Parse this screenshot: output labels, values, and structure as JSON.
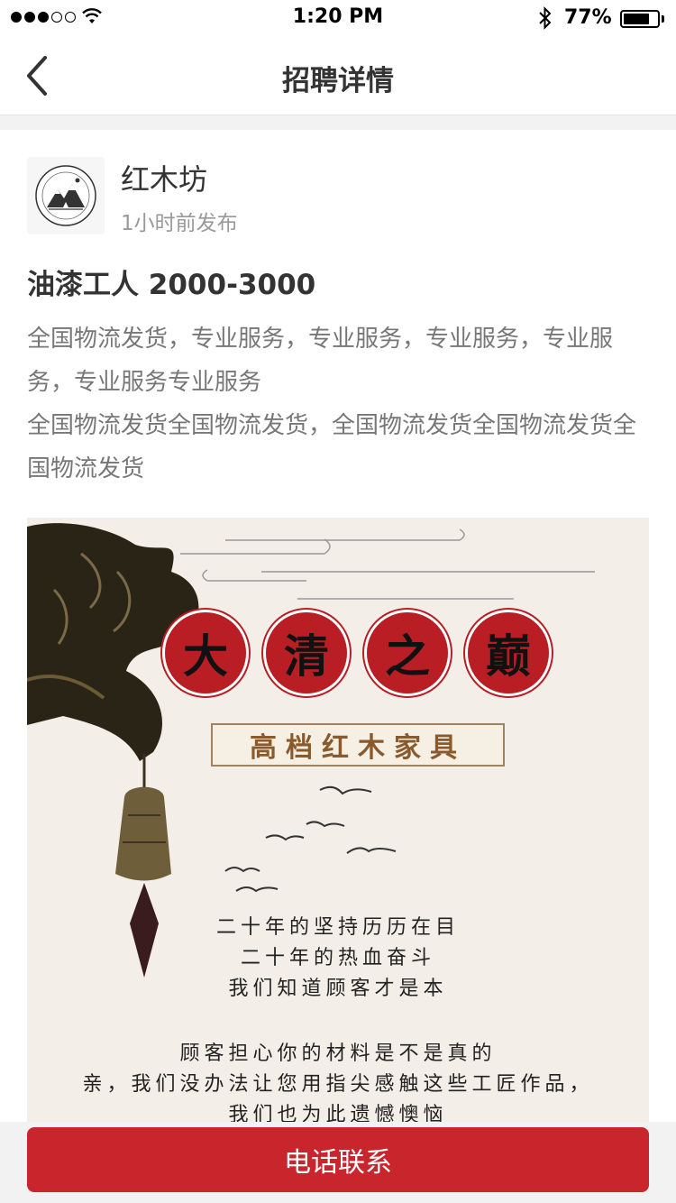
{
  "status_bar": {
    "time": "1:20 PM",
    "battery_percent": "77%",
    "battery_level": 0.77,
    "signal_bars_filled": 3,
    "signal_bars_total": 5
  },
  "nav": {
    "title": "招聘详情",
    "back_icon": "chevron-left-icon"
  },
  "company": {
    "name": "红木坊",
    "posted": "1小时前发布",
    "avatar_icon": "mountain-logo-icon"
  },
  "job": {
    "title": "油漆工人 2000-3000",
    "description": [
      "全国物流发货，专业服务，专业服务，专业服务，专业服务，专业服务专业服务",
      "全国物流发货全国物流发货，全国物流发货全国物流发货全国物流发货"
    ]
  },
  "poster": {
    "seals": [
      "大",
      "清",
      "之",
      "巅"
    ],
    "banner": "高档红木家具",
    "poem_lines": [
      "二十年的坚持历历在目",
      "二十年的热血奋斗",
      "我们知道顾客才是本",
      "顾客担心你的材料是不是真的",
      "亲，我们没办法让您用指尖感触这些工匠作品，",
      "我们也为此遗憾懊恼"
    ],
    "colors": {
      "seal_red": "#b81e24",
      "banner_text": "#8a5a2c",
      "background": "#f3eee7"
    }
  },
  "actions": {
    "call_label": "电话联系",
    "accent_color": "#c9252c"
  }
}
